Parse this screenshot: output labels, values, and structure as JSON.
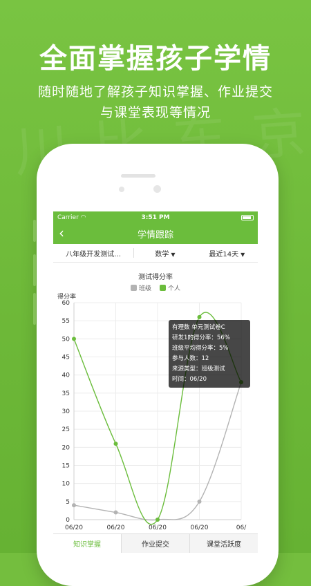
{
  "promo": {
    "headline": "全面掌握孩子学情",
    "sub1": "随时随地了解孩子知识掌握、作业提交",
    "sub2": "与课堂表现等情况"
  },
  "status": {
    "carrier": "Carrier",
    "time": "3:51 PM"
  },
  "nav": {
    "title": "学情跟踪",
    "back_icon": "chevron-left-icon"
  },
  "filters": {
    "exam": "八年级开发测试…",
    "subject": "数学",
    "range": "最近14天"
  },
  "chart_data": {
    "type": "line",
    "title": "测试得分率",
    "ylabel": "得分率",
    "ylim": [
      0,
      60
    ],
    "yticks": [
      0,
      5,
      10,
      15,
      20,
      25,
      30,
      35,
      40,
      45,
      50,
      55,
      60
    ],
    "categories": [
      "06/20",
      "06/20",
      "06/20",
      "06/20",
      "06/"
    ],
    "series": [
      {
        "name": "班级",
        "color": "#b3b3b3",
        "values": [
          4,
          2,
          0,
          5,
          38
        ]
      },
      {
        "name": "个人",
        "color": "#6bbd3c",
        "values": [
          50,
          21,
          0,
          56,
          38
        ]
      }
    ],
    "grid": true,
    "legend": "top-center"
  },
  "tooltip": {
    "line1": "有理数 单元测试卷C",
    "line2": "研发1的得分率：56%",
    "line3": "班级平均得分率：5%",
    "line4": "参与人数：12",
    "line5": "来源类型：班级测试",
    "line6": "时间：06/20"
  },
  "tabs": {
    "knowledge": "知识掌握",
    "homework": "作业提交",
    "activity": "课堂活跃度"
  },
  "colors": {
    "brand_green": "#6bbd3c",
    "class_gray": "#b3b3b3"
  }
}
